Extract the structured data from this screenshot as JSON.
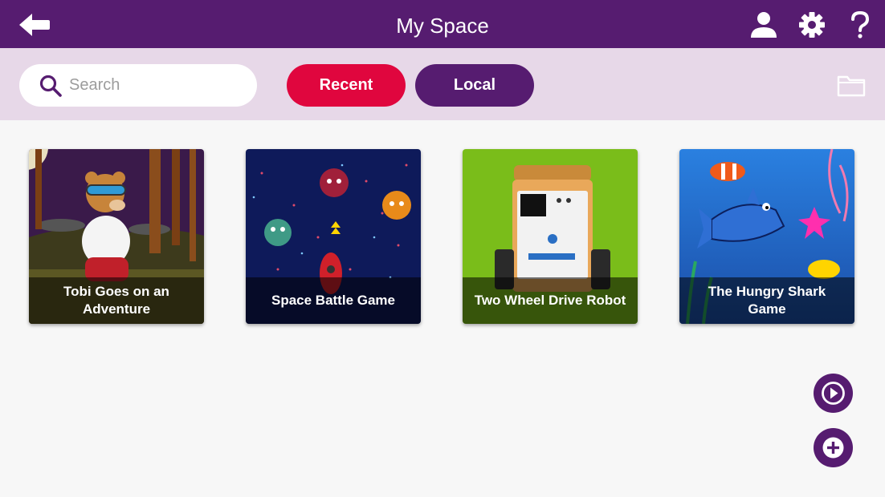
{
  "header": {
    "title": "My Space",
    "icons": {
      "back": "back-arrow-icon",
      "account": "user-icon",
      "settings": "gear-icon",
      "help": "help-icon"
    }
  },
  "toolbar": {
    "search": {
      "placeholder": "Search",
      "value": ""
    },
    "tabs": [
      {
        "label": "Recent",
        "active": true
      },
      {
        "label": "Local",
        "active": false
      }
    ],
    "folder_icon": "folder-icon"
  },
  "projects": [
    {
      "title": "Tobi Goes on an Adventure"
    },
    {
      "title": "Space Battle Game"
    },
    {
      "title": "Two Wheel Drive Robot"
    },
    {
      "title": "The Hungry Shark Game"
    }
  ],
  "fabs": {
    "run_icon": "play-icon",
    "add_icon": "plus-icon"
  },
  "colors": {
    "header": "#561c70",
    "toolbar": "#e7d8e8",
    "recent": "#e0063e",
    "local": "#561c70",
    "background": "#f7f7f7"
  }
}
